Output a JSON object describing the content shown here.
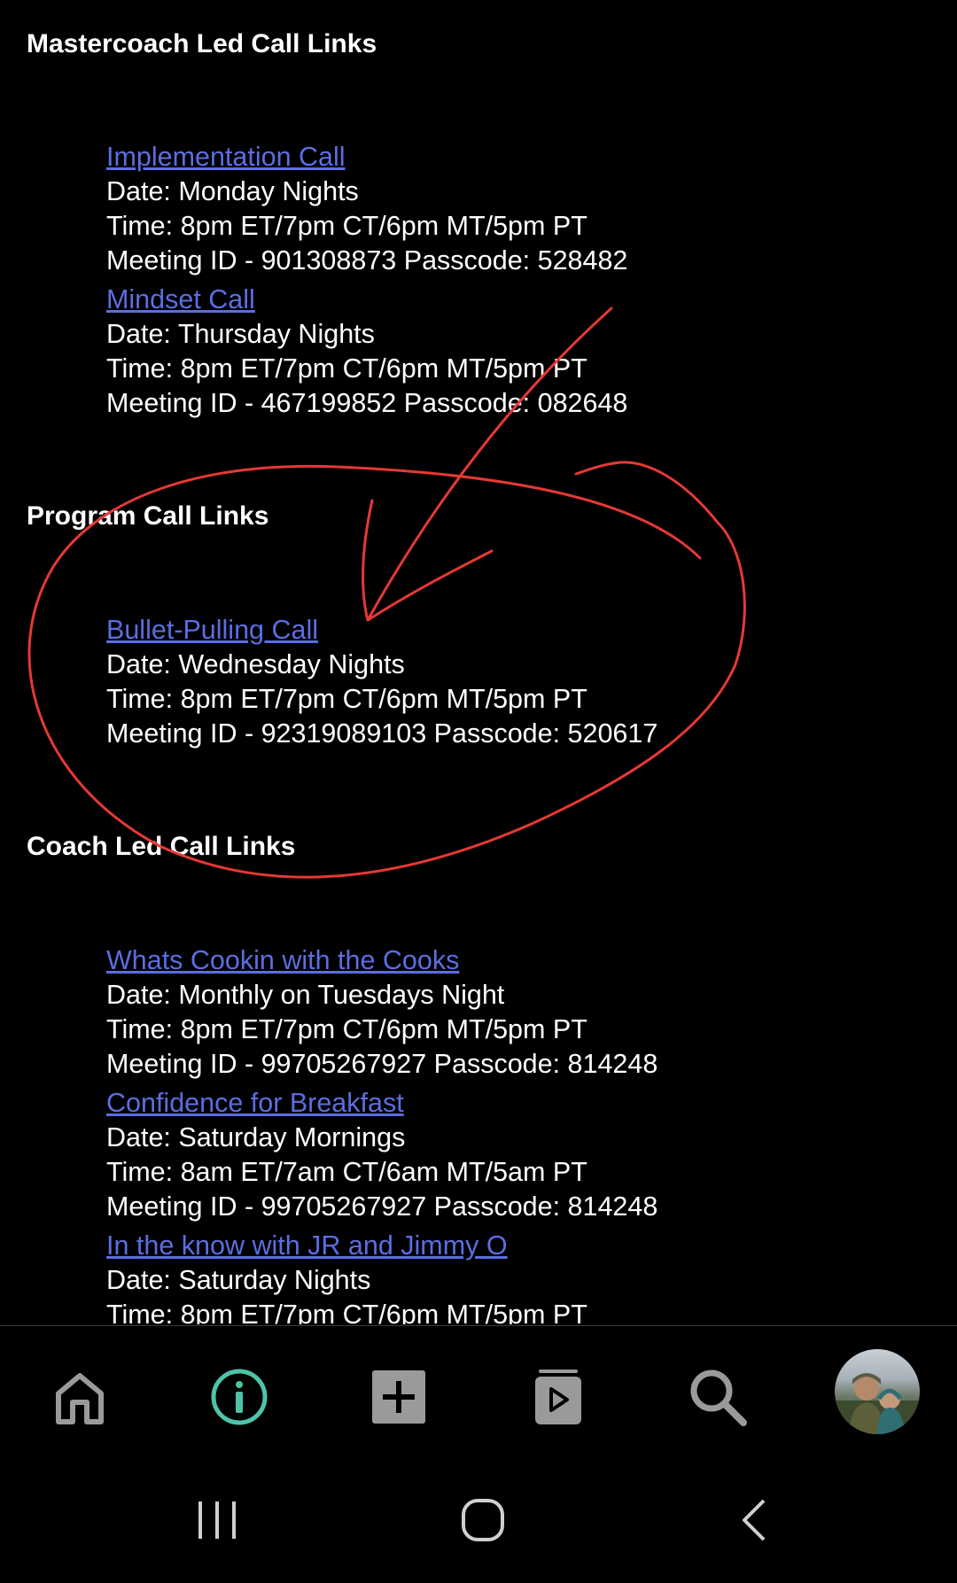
{
  "sections": {
    "mastercoach": {
      "title": "Mastercoach Led Call Links",
      "entries": [
        {
          "link": "Implementation Call",
          "date": "Date: Monday Nights",
          "time": "Time: 8pm ET/7pm CT/6pm MT/5pm PT",
          "meeting": "Meeting ID - 901308873 Passcode: 528482"
        },
        {
          "link": "Mindset Call",
          "date": "Date: Thursday Nights",
          "time": "Time: 8pm ET/7pm CT/6pm MT/5pm PT",
          "meeting": "Meeting ID - 467199852 Passcode: 082648"
        }
      ]
    },
    "program": {
      "title": "Program Call Links",
      "entries": [
        {
          "link": "Bullet-Pulling Call",
          "date": "Date: Wednesday Nights",
          "time": "Time: 8pm ET/7pm CT/6pm MT/5pm PT",
          "meeting": "Meeting ID - 92319089103 Passcode: 520617"
        }
      ]
    },
    "coach": {
      "title": "Coach Led Call Links",
      "entries": [
        {
          "link": "Whats Cookin with the Cooks",
          "date": "Date: Monthly on Tuesdays Night",
          "time": "Time: 8pm ET/7pm CT/6pm MT/5pm PT",
          "meeting": "Meeting ID - 99705267927 Passcode: 814248"
        },
        {
          "link": "Confidence for Breakfast",
          "date": "Date: Saturday Mornings",
          "time": "Time: 8am ET/7am CT/6am MT/5am PT",
          "meeting": "Meeting ID - 99705267927 Passcode: 814248"
        },
        {
          "link": "In the know with JR and Jimmy O",
          "date": "Date: Saturday Nights",
          "time": "Time: 8pm ET/7pm CT/6pm MT/5pm PT"
        }
      ]
    }
  },
  "bottom_nav": {
    "items": [
      {
        "icon": "home-icon",
        "active": false
      },
      {
        "icon": "info-icon",
        "active": true
      },
      {
        "icon": "add-icon",
        "active": false
      },
      {
        "icon": "video-library-icon",
        "active": false
      },
      {
        "icon": "search-icon",
        "active": false
      },
      {
        "icon": "avatar",
        "active": false
      }
    ]
  },
  "system_nav": {
    "items": [
      {
        "icon": "recent-apps-icon"
      },
      {
        "icon": "home-circle-icon"
      },
      {
        "icon": "back-icon"
      }
    ]
  },
  "colors": {
    "background": "#000000",
    "text": "#ffffff",
    "link": "#5b6ee1",
    "active_nav": "#4fc3a8",
    "inactive_nav": "#9a9a9a",
    "annotation": "#e53935"
  }
}
